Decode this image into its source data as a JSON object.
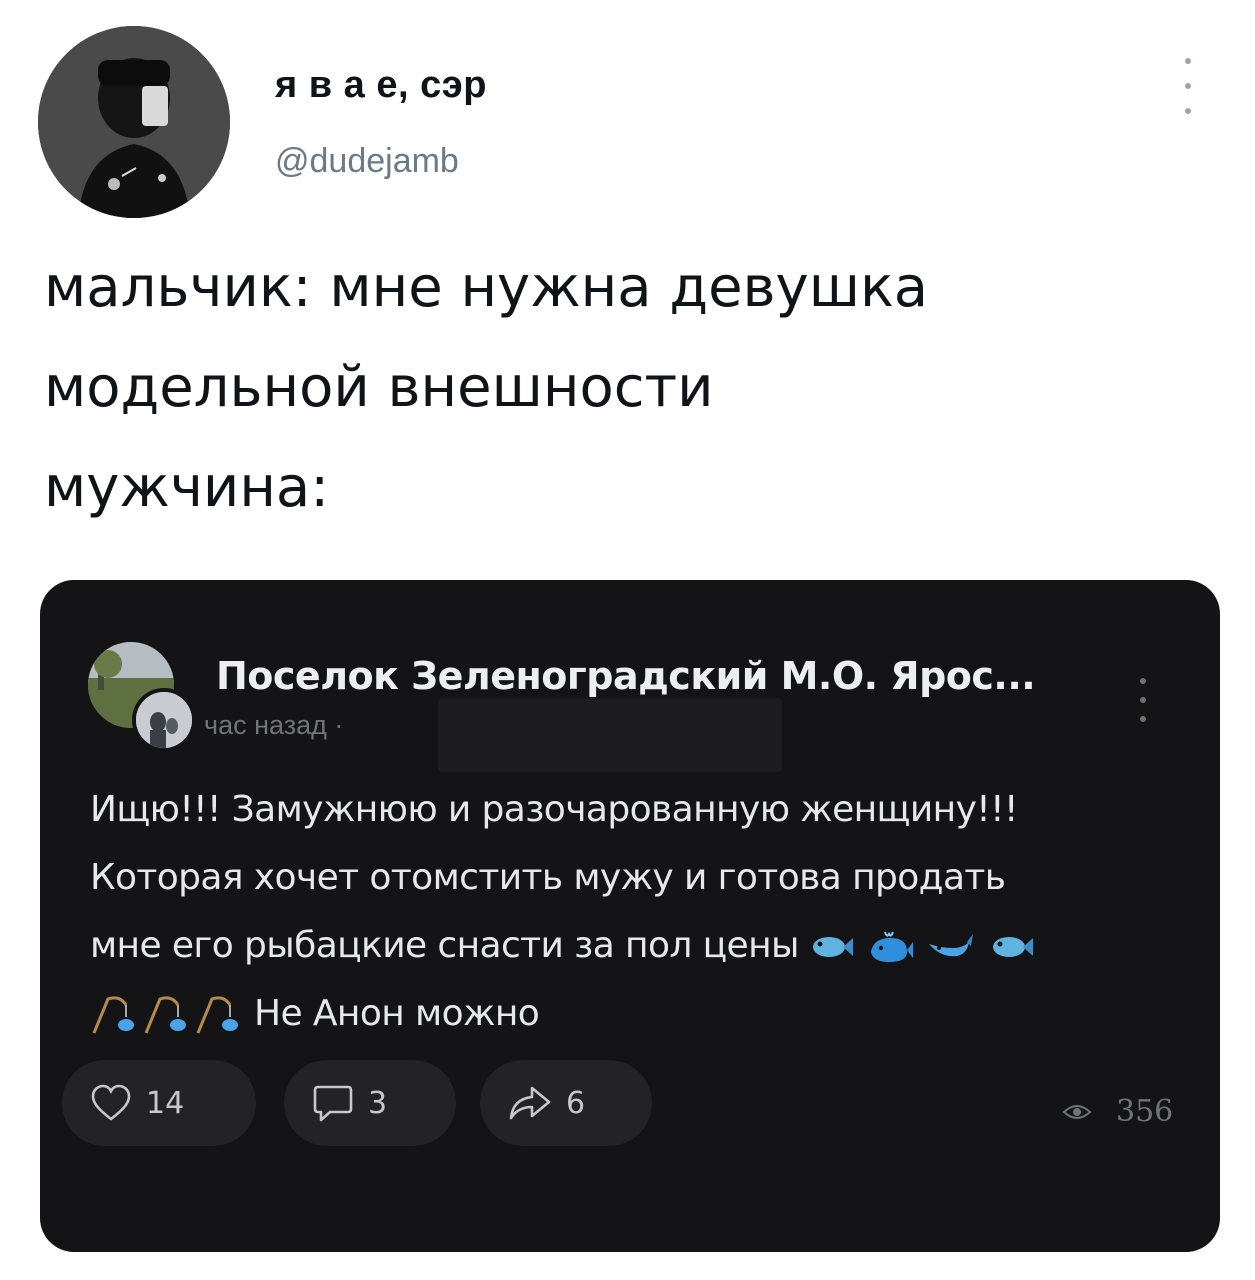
{
  "tweet": {
    "author": {
      "display_name": "я в а  е, сэр",
      "handle": "@dudejamb"
    },
    "text_lines": [
      "мальчик: мне нужна девушка",
      "модельной внешности",
      "мужчина:"
    ]
  },
  "embedded_post": {
    "group_name": "Поселок Зеленоградский М.О. Ярос...",
    "time": "час назад ·",
    "body_lines": [
      "Ищю!!! Замужнюю и разочарованную женщину!!!",
      "Которая хочет отомстить мужу и готова продать",
      "мне его рыбацкие снасти за пол цены",
      "Не Анон можно"
    ],
    "emojis_line3": [
      "fish-icon",
      "whale-icon",
      "whale-icon",
      "fish-icon"
    ],
    "emojis_line4": [
      "fishing-pole-icon",
      "fishing-pole-icon",
      "fishing-pole-icon"
    ],
    "actions": {
      "likes": "14",
      "comments": "3",
      "shares": "6",
      "views": "356"
    }
  },
  "colors": {
    "card_bg": "#141416",
    "pill_bg": "#232326",
    "text_dark": "#0f1419",
    "handle_gray": "#6b7a86"
  }
}
